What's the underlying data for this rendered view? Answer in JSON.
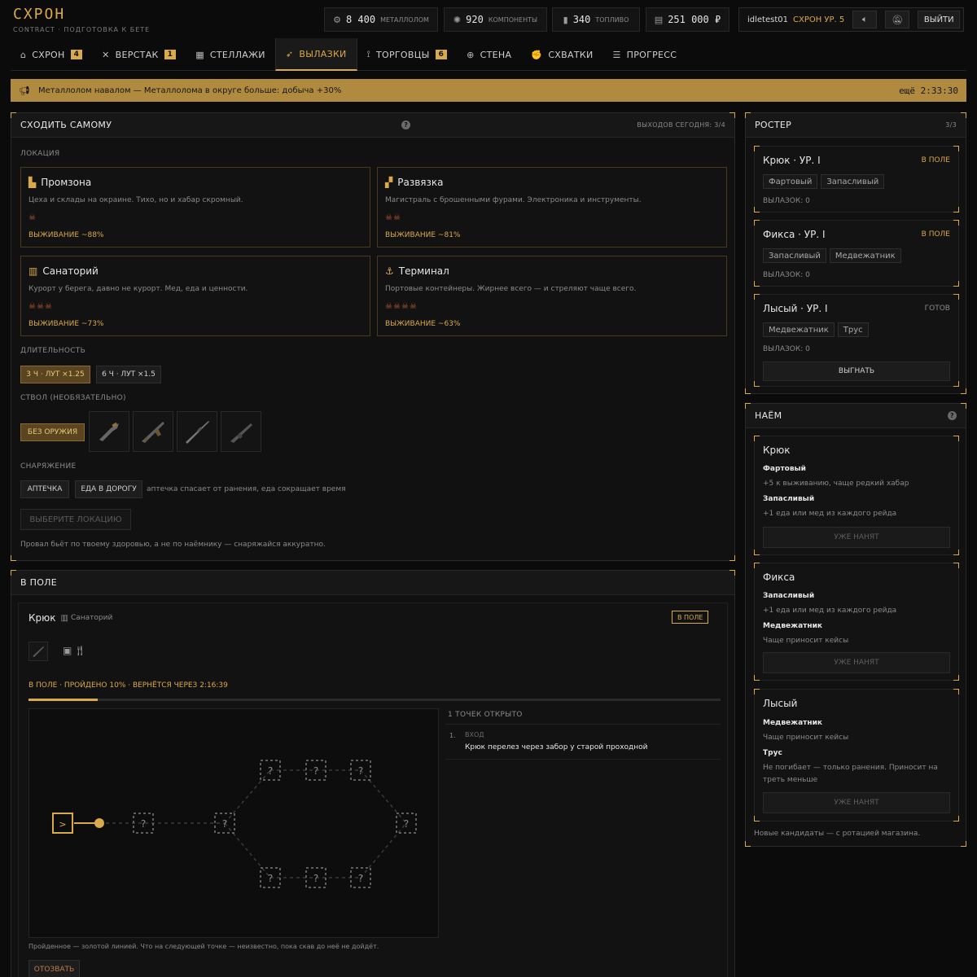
{
  "brand": {
    "title": "СХРОН",
    "subtitle": "CONTRACT · ПОДГОТОВКА К БЕТЕ"
  },
  "resources": [
    {
      "icon": "scrap-icon",
      "glyph": "⚙",
      "value": "8 400",
      "label": "МЕТАЛЛОЛОМ"
    },
    {
      "icon": "components-icon",
      "glyph": "✺",
      "value": "920",
      "label": "КОМПОНЕНТЫ"
    },
    {
      "icon": "fuel-icon",
      "glyph": "▮",
      "value": "340",
      "label": "ТОПЛИВО"
    },
    {
      "icon": "money-icon",
      "glyph": "▤",
      "value": "251 000 ₽",
      "label": ""
    }
  ],
  "user": {
    "name": "idletest01",
    "level": "СХРОН УР. 5",
    "logout": "ВЫЙТИ"
  },
  "tabs": [
    {
      "icon": "bunker-icon",
      "glyph": "⌂",
      "label": "СХРОН",
      "badge": "4",
      "active": false
    },
    {
      "icon": "workbench-icon",
      "glyph": "✕",
      "label": "ВЕРСТАК",
      "badge": "1",
      "active": false
    },
    {
      "icon": "shelves-icon",
      "glyph": "▦",
      "label": "СТЕЛЛАЖИ",
      "badge": "",
      "active": false
    },
    {
      "icon": "runner-icon",
      "glyph": "➶",
      "label": "ВЫЛАЗКИ",
      "badge": "",
      "active": true
    },
    {
      "icon": "antenna-icon",
      "glyph": "⟟",
      "label": "ТОРГОВЦЫ",
      "badge": "6",
      "active": false
    },
    {
      "icon": "crosshair-icon",
      "glyph": "⊕",
      "label": "СТЕНА",
      "badge": "",
      "active": false
    },
    {
      "icon": "fist-icon",
      "glyph": "✊",
      "label": "СХВАТКИ",
      "badge": "",
      "active": false
    },
    {
      "icon": "list-icon",
      "glyph": "☰",
      "label": "ПРОГРЕСС",
      "badge": "",
      "active": false
    }
  ],
  "event": {
    "text": "Металлолом навалом — Металлолома в округе больше: добыча +30%",
    "timer": "ещё 2:33:30"
  },
  "solo": {
    "title": "СХОДИТЬ САМОМУ",
    "runs": "ВЫХОДОВ СЕГОДНЯ: 3/4",
    "location_label": "ЛОКАЦИЯ",
    "locations": [
      {
        "icon": "factory-icon",
        "glyph": "▙",
        "name": "Промзона",
        "desc": "Цеха и склады на окраине. Тихо, но и хабар скромный.",
        "skulls": "☠",
        "survival": "ВЫЖИВАНИЕ ~88%"
      },
      {
        "icon": "truck-icon",
        "glyph": "▞",
        "name": "Развязка",
        "desc": "Магистраль с брошенными фурами. Электроника и инструменты.",
        "skulls": "☠☠",
        "survival": "ВЫЖИВАНИЕ ~81%"
      },
      {
        "icon": "building-icon",
        "glyph": "▥",
        "name": "Санаторий",
        "desc": "Курорт у берега, давно не курорт. Мед, еда и ценности.",
        "skulls": "☠☠☠",
        "survival": "ВЫЖИВАНИЕ ~73%"
      },
      {
        "icon": "anchor-icon",
        "glyph": "⚓",
        "name": "Терминал",
        "desc": "Портовые контейнеры. Жирнее всего — и стреляют чаще всего.",
        "skulls": "☠☠☠☠",
        "survival": "ВЫЖИВАНИЕ ~63%"
      }
    ],
    "duration_label": "ДЛИТЕЛЬНОСТЬ",
    "durations": [
      {
        "label": "3 Ч · ЛУТ ×1.25",
        "active": true
      },
      {
        "label": "6 Ч · ЛУТ ×1.5",
        "active": false
      }
    ],
    "weapon_label": "СТВОЛ (НЕОБЯЗАТЕЛЬНО)",
    "no_weapon": "БЕЗ ОРУЖИЯ",
    "weapons": [
      "pistol-icon",
      "ak-icon",
      "rifle-icon",
      "smg-icon"
    ],
    "gear_label": "СНАРЯЖЕНИЕ",
    "gear": [
      "АПТЕЧКА",
      "ЕДА В ДОРОГУ"
    ],
    "gear_hint": "аптечка спасает от ранения, еда сокращает время",
    "submit": "ВЫБЕРИТЕ ЛОКАЦИЮ",
    "footer": "Провал бьёт по твоему здоровью, а не по наёмнику — снаряжайся аккуратно."
  },
  "field": {
    "title": "В ПОЛЕ",
    "mission": {
      "name": "Крюк",
      "location": "Санаторий",
      "status": "В ПОЛЕ",
      "progress_text": "В ПОЛЕ · ПРОЙДЕНО 10% · ВЕРНЁТСЯ ЧЕРЕЗ 2:16:39",
      "progress": 0.1,
      "points_title": "1 ТОЧЕК ОТКРЫТО",
      "log": [
        {
          "num": "1.",
          "kind": "ВХОД",
          "text": "Крюк перелез через забор у старой проходной"
        }
      ],
      "note": "Пройденное — золотой линией. Что на следующей точке — неизвестно, пока скав до неё не дойдёт.",
      "recall": "ОТОЗВАТЬ",
      "start_glyph": ">",
      "unknown_glyph": "?"
    }
  },
  "roster": {
    "title": "РОСТЕР",
    "count": "3/3",
    "members": [
      {
        "name": "Крюк · УР. I",
        "status": "В ПОЛЕ",
        "ready": false,
        "tags": [
          "Фартовый",
          "Запасливый"
        ],
        "runs": "ВЫЛАЗОК: 0"
      },
      {
        "name": "Фикса · УР. I",
        "status": "В ПОЛЕ",
        "ready": false,
        "tags": [
          "Запасливый",
          "Медвежатник"
        ],
        "runs": "ВЫЛАЗОК: 0"
      },
      {
        "name": "Лысый · УР. I",
        "status": "ГОТОВ",
        "ready": true,
        "tags": [
          "Медвежатник",
          "Трус"
        ],
        "runs": "ВЫЛАЗОК: 0"
      }
    ],
    "send": "ВЫГНАТЬ"
  },
  "hire": {
    "title": "НАЁМ",
    "candidates": [
      {
        "name": "Крюк",
        "traits": [
          {
            "n": "Фартовый",
            "d": "+5 к выживанию, чаще редкий хабар"
          },
          {
            "n": "Запасливый",
            "d": "+1 еда или мед из каждого рейда"
          }
        ],
        "btn": "УЖЕ НАНЯТ"
      },
      {
        "name": "Фикса",
        "traits": [
          {
            "n": "Запасливый",
            "d": "+1 еда или мед из каждого рейда"
          },
          {
            "n": "Медвежатник",
            "d": "Чаще приносит кейсы"
          }
        ],
        "btn": "УЖЕ НАНЯТ"
      },
      {
        "name": "Лысый",
        "traits": [
          {
            "n": "Медвежатник",
            "d": "Чаще приносит кейсы"
          },
          {
            "n": "Трус",
            "d": "Не погибает — только ранения. Приносит на треть меньше"
          }
        ],
        "btn": "УЖЕ НАНЯТ"
      }
    ],
    "footer": "Новые кандидаты — с ротацией магазина."
  },
  "colors": {
    "accent": "#d9a94a",
    "event_bg": "#b08a3e",
    "danger": "#b85a3a"
  }
}
